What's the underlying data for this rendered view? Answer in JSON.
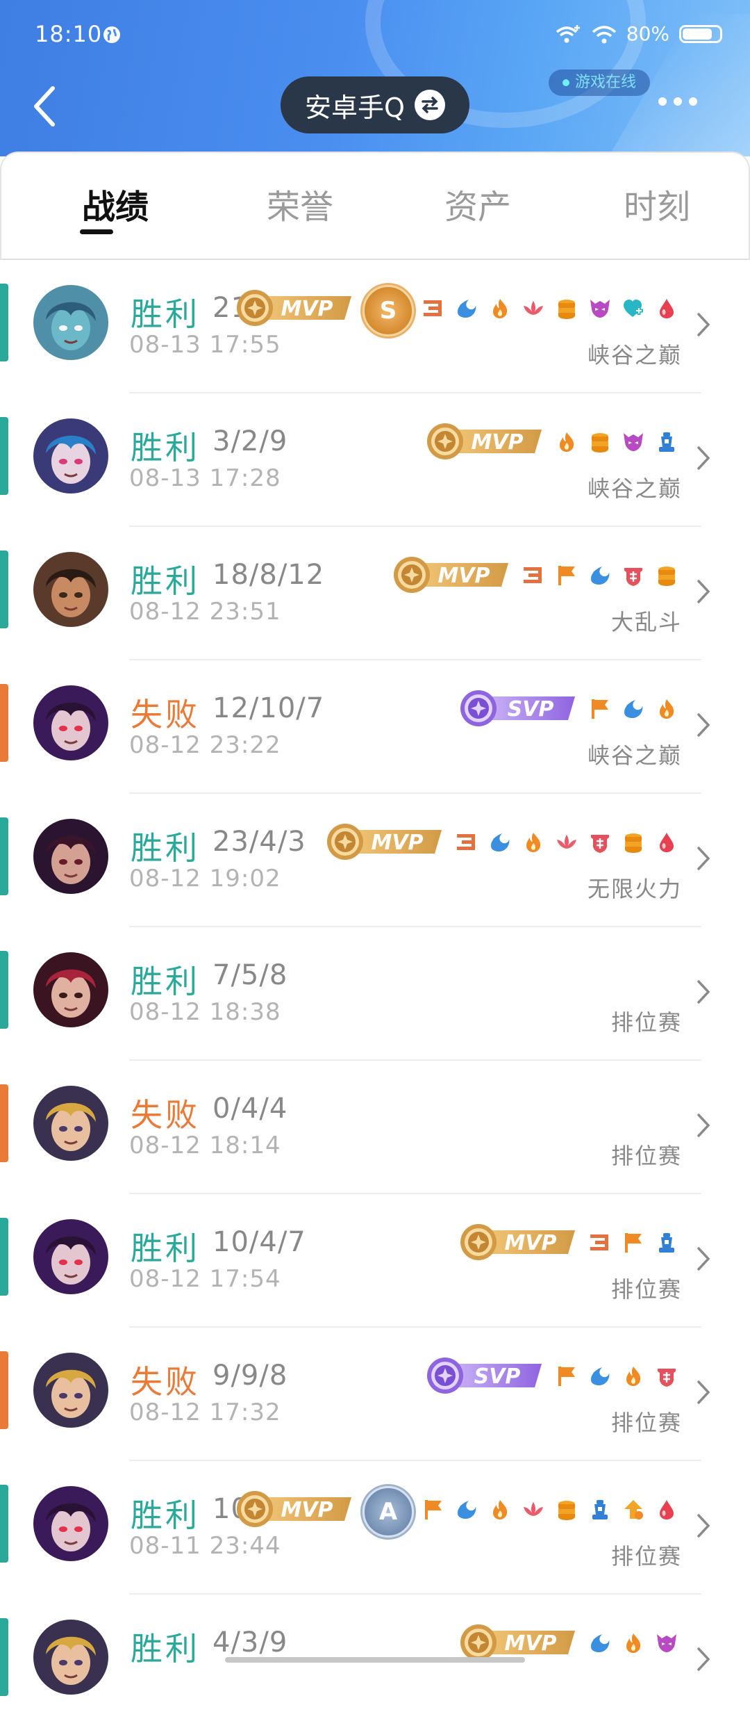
{
  "status_bar": {
    "time": "18:10",
    "battery": "80%",
    "battery_level": 0.8
  },
  "header": {
    "online_label": "游戏在线",
    "account": "安卓手Q"
  },
  "tabs": [
    {
      "label": "战绩",
      "active": true
    },
    {
      "label": "荣誉",
      "active": false
    },
    {
      "label": "资产",
      "active": false
    },
    {
      "label": "时刻",
      "active": false
    }
  ],
  "colors": {
    "win": "#2aa89a",
    "loss": "#ea7a37",
    "mvp": "#d9a24c",
    "svp": "#9a74e6"
  },
  "records": [
    {
      "result": "胜利",
      "outcome": "win",
      "kda": "21/",
      "time": "08-13 17:55",
      "mode": "峡谷之巅",
      "badge": "MVP",
      "grade": "S",
      "avatar": "fish",
      "icons": [
        "triple",
        "penta-blue",
        "flame",
        "lotus",
        "coins",
        "demon",
        "heart-plus",
        "blood"
      ]
    },
    {
      "result": "胜利",
      "outcome": "win",
      "kda": "3/2/9",
      "time": "08-13 17:28",
      "mode": "峡谷之巅",
      "badge": "MVP",
      "grade": "",
      "avatar": "jinx",
      "icons": [
        "flame",
        "coins",
        "demon",
        "tower"
      ]
    },
    {
      "result": "胜利",
      "outcome": "win",
      "kda": "18/8/12",
      "time": "08-12 23:51",
      "mode": "大乱斗",
      "badge": "MVP",
      "grade": "",
      "avatar": "man",
      "icons": [
        "triple",
        "flag",
        "penta-blue",
        "shield",
        "coins"
      ]
    },
    {
      "result": "失败",
      "outcome": "loss",
      "kda": "12/10/7",
      "time": "08-12 23:22",
      "mode": "峡谷之巅",
      "badge": "SVP",
      "grade": "",
      "avatar": "vayne",
      "icons": [
        "flag",
        "penta-blue",
        "flame"
      ]
    },
    {
      "result": "胜利",
      "outcome": "win",
      "kda": "23/4/3",
      "time": "08-12 19:02",
      "mode": "无限火力",
      "badge": "MVP",
      "grade": "",
      "avatar": "akali",
      "icons": [
        "triple",
        "penta-blue",
        "flame",
        "lotus",
        "shield",
        "coins",
        "blood"
      ]
    },
    {
      "result": "胜利",
      "outcome": "win",
      "kda": "7/5/8",
      "time": "08-12 18:38",
      "mode": "排位赛",
      "badge": "",
      "grade": "",
      "avatar": "katarina",
      "icons": []
    },
    {
      "result": "失败",
      "outcome": "loss",
      "kda": "0/4/4",
      "time": "08-12 18:14",
      "mode": "排位赛",
      "badge": "",
      "grade": "",
      "avatar": "ezreal",
      "icons": []
    },
    {
      "result": "胜利",
      "outcome": "win",
      "kda": "10/4/7",
      "time": "08-12 17:54",
      "mode": "排位赛",
      "badge": "MVP",
      "grade": "",
      "avatar": "vayne",
      "icons": [
        "triple",
        "flag",
        "tower"
      ]
    },
    {
      "result": "失败",
      "outcome": "loss",
      "kda": "9/9/8",
      "time": "08-12 17:32",
      "mode": "排位赛",
      "badge": "SVP",
      "grade": "",
      "avatar": "ezreal",
      "icons": [
        "flag",
        "penta-blue",
        "flame",
        "shield"
      ]
    },
    {
      "result": "胜利",
      "outcome": "win",
      "kda": "10/",
      "time": "08-11 23:44",
      "mode": "排位赛",
      "badge": "MVP",
      "grade": "A",
      "avatar": "vayne",
      "icons": [
        "flag",
        "penta-blue",
        "flame",
        "lotus",
        "coins",
        "tower",
        "up-arrow",
        "blood"
      ]
    },
    {
      "result": "胜利",
      "outcome": "win",
      "kda": "4/3/9",
      "time": "",
      "mode": "",
      "badge": "MVP",
      "grade": "",
      "avatar": "ezreal",
      "icons": [
        "penta-blue",
        "flame",
        "demon"
      ]
    }
  ]
}
